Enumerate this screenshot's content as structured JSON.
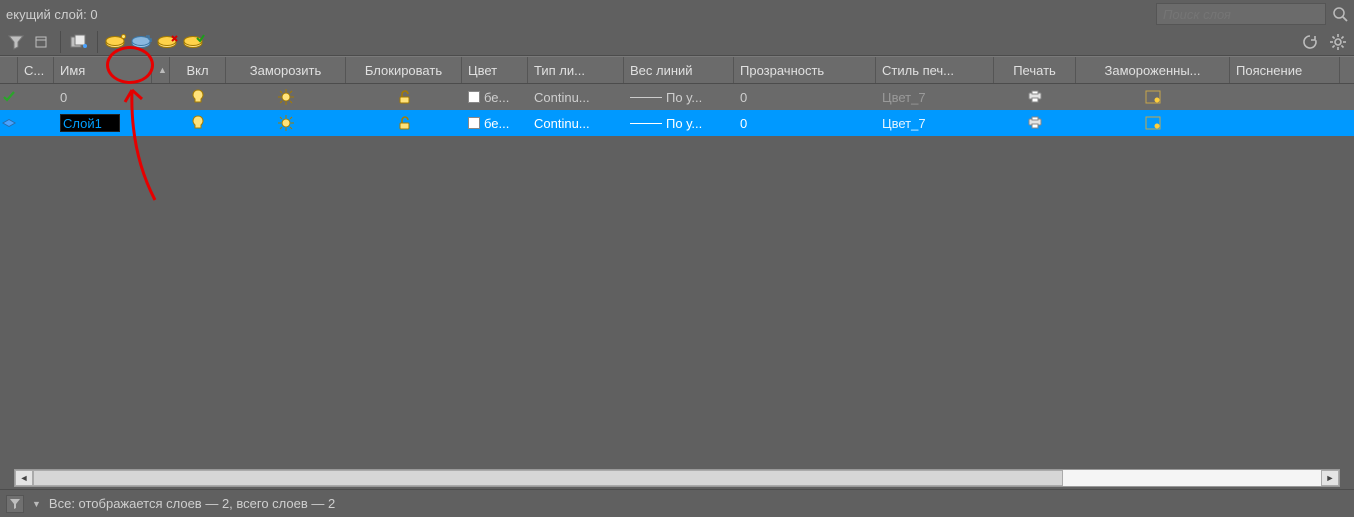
{
  "header": {
    "current_layer_label": "екущий слой: 0"
  },
  "search": {
    "placeholder": "Поиск слоя"
  },
  "columns": {
    "status": "С...",
    "name": "Имя",
    "on": "Вкл",
    "freeze": "Заморозить",
    "lock": "Блокировать",
    "color": "Цвет",
    "linetype": "Тип ли...",
    "lineweight": "Вес линий",
    "transparency": "Прозрачность",
    "plotstyle": "Стиль печ...",
    "plot": "Печать",
    "vpfreeze": "Замороженны...",
    "description": "Пояснение"
  },
  "rows": [
    {
      "name": "0",
      "color_label": "бе...",
      "linetype": "Continu...",
      "lineweight": "По у...",
      "transparency": "0",
      "plotstyle": "Цвет_7"
    },
    {
      "name": "Слой1",
      "color_label": "бе...",
      "linetype": "Continu...",
      "lineweight": "По у...",
      "transparency": "0",
      "plotstyle": "Цвет_7"
    }
  ],
  "status_bar": {
    "filter_label": "Все: отображается слоев — 2, всего слоев — 2"
  }
}
